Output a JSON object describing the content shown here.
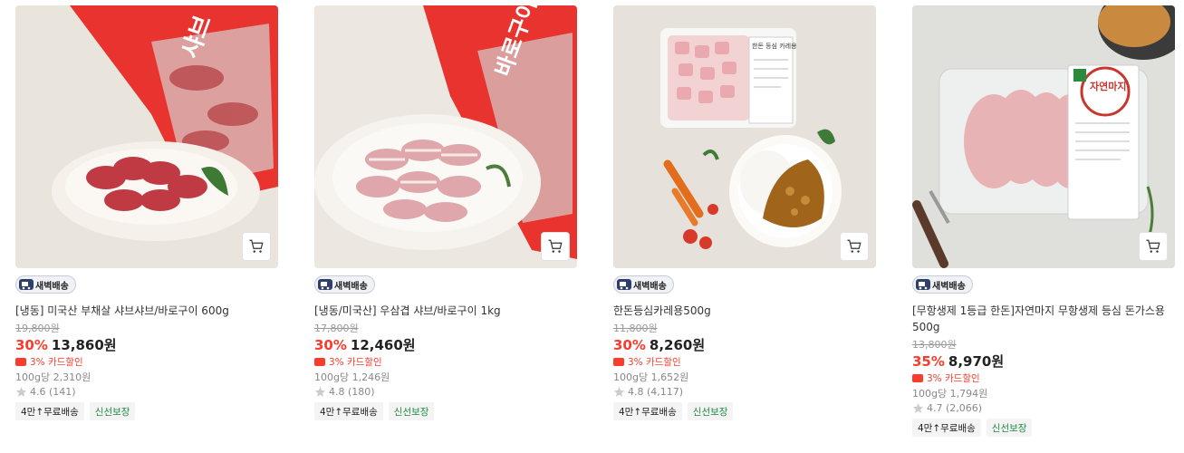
{
  "dawn_badge_label": "새벽배송",
  "products": [
    {
      "name": "[냉동] 미국산 부채살 샤브샤브/바로구이 600g",
      "original_price": "19,800원",
      "discount_rate": "30%",
      "price": "13,860원",
      "card_discount": "3% 카드할인",
      "unit_price": "100g당 2,310원",
      "rating": "4.6",
      "review_count": "(141)",
      "tag_shipping": "4만↑무료배송",
      "tag_fresh": "신선보장",
      "image": "frozen-beef-brisket-shabu-pack"
    },
    {
      "name": "[냉동/미국산] 우삼겹 샤브/바로구이 1kg",
      "original_price": "17,800원",
      "discount_rate": "30%",
      "price": "12,460원",
      "card_discount": "3% 카드할인",
      "unit_price": "100g당 1,246원",
      "rating": "4.8",
      "review_count": "(180)",
      "tag_shipping": "4만↑무료배송",
      "tag_fresh": "신선보장",
      "image": "frozen-beef-rolls-pack"
    },
    {
      "name": "한돈등심카레용500g",
      "original_price": "11,800원",
      "discount_rate": "30%",
      "price": "8,260원",
      "card_discount": "3% 카드할인",
      "unit_price": "100g당 1,652원",
      "rating": "4.8",
      "review_count": "(4,117)",
      "tag_shipping": "4만↑무료배송",
      "tag_fresh": "신선보장",
      "image": "pork-loin-curry-cubes"
    },
    {
      "name": "[무항생제 1등급 한돈]자연마지 무항생제 등심 돈가스용 500g",
      "original_price": "13,800원",
      "discount_rate": "35%",
      "price": "8,970원",
      "card_discount": "3% 카드할인",
      "unit_price": "100g당 1,794원",
      "rating": "4.7",
      "review_count": "(2,066)",
      "tag_shipping": "4만↑무료배송",
      "tag_fresh": "신선보장",
      "image": "pork-loin-cutlet-tray",
      "label_text": "자연마지"
    }
  ],
  "colors": {
    "discount_red": "#fa3c2d",
    "fresh_green": "#1e8a47",
    "star_gray": "#cccccc"
  }
}
